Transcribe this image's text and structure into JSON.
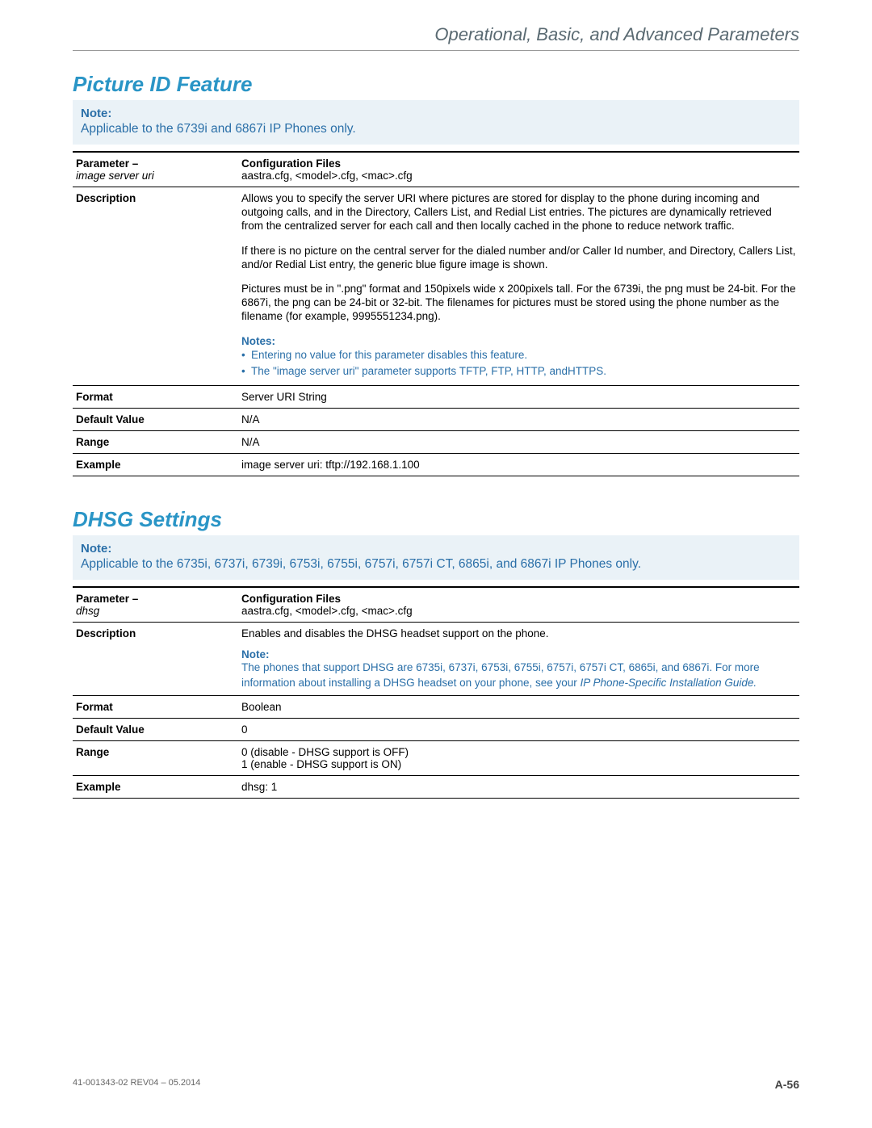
{
  "header": {
    "running_title": "Operational, Basic, and Advanced Parameters"
  },
  "section1": {
    "title": "Picture ID Feature",
    "note_label": "Note:",
    "note_text": "Applicable to the 6739i and 6867i IP Phones only.",
    "table": {
      "param_label": "Parameter –",
      "param_name": "image server uri",
      "cfg_label": "Configuration Files",
      "cfg_value": "aastra.cfg, <model>.cfg, <mac>.cfg",
      "desc_label": "Description",
      "desc_p1": "Allows you to specify the server URI where pictures are stored for display to the phone during incoming and outgoing calls, and in the Directory, Callers List, and Redial List entries. The pictures are dynamically retrieved from the centralized server for each call and then locally cached in the phone to reduce network traffic.",
      "desc_p2": "If there is no picture on the central server for the dialed number and/or Caller Id number, and Directory, Callers List, and/or Redial List entry, the generic blue figure image is shown.",
      "desc_p3": "Pictures must be in \".png\" format and 150pixels wide x 200pixels tall. For the 6739i, the png must be 24-bit. For the 6867i, the png can be 24-bit or 32-bit. The filenames for pictures must be stored using the phone number as the filename (for example, 9995551234.png).",
      "notes_label": "Notes:",
      "bullet1": "Entering no value for this parameter disables this feature.",
      "bullet2": "The \"image server uri\" parameter supports TFTP, FTP, HTTP, andHTTPS.",
      "format_label": "Format",
      "format_value": "Server URI String",
      "default_label": "Default Value",
      "default_value": "N/A",
      "range_label": "Range",
      "range_value": "N/A",
      "example_label": "Example",
      "example_value": "image server uri: tftp://192.168.1.100"
    }
  },
  "section2": {
    "title": "DHSG Settings",
    "note_label": "Note:",
    "note_text": "Applicable to the 6735i, 6737i, 6739i, 6753i, 6755i, 6757i, 6757i CT, 6865i, and 6867i IP Phones only.",
    "table": {
      "param_label": "Parameter –",
      "param_name": "dhsg",
      "cfg_label": "Configuration Files",
      "cfg_value": "aastra.cfg, <model>.cfg, <mac>.cfg",
      "desc_label": "Description",
      "desc_p1": "Enables and disables the DHSG headset support on the phone.",
      "note_label": "Note:",
      "note_text_a": "The phones that support DHSG are 6735i, 6737i, 6753i, 6755i, 6757i, 6757i CT, 6865i, and 6867i. For more information about installing a DHSG headset on your phone, see your ",
      "note_text_b": "IP Phone-Specific Installation Guide.",
      "format_label": "Format",
      "format_value": "Boolean",
      "default_label": "Default Value",
      "default_value": "0",
      "range_label": "Range",
      "range_line1": "0 (disable - DHSG support is OFF)",
      "range_line2": "1 (enable - DHSG support is ON)",
      "example_label": "Example",
      "example_value": "dhsg: 1"
    }
  },
  "footer": {
    "doc_id": "41-001343-02 REV04 – 05.2014",
    "page_num": "A-56"
  }
}
